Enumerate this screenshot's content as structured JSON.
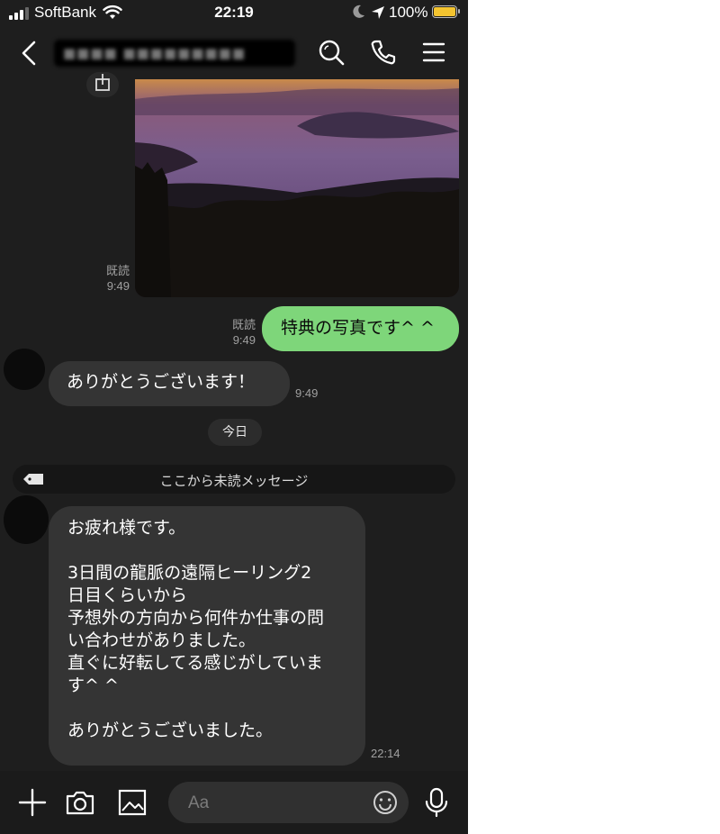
{
  "status_bar": {
    "carrier": "SoftBank",
    "time": "22:19",
    "battery_percent": "100%",
    "battery_level": 1.0,
    "battery_color": "#f4c430"
  },
  "header": {
    "title_redacted": "■■■■ ■■■■■■■■■",
    "icons": [
      "back-chevron-icon",
      "search-icon",
      "phone-icon",
      "menu-icon"
    ]
  },
  "messages": {
    "photo": {
      "read_label": "既読",
      "time": "9:49"
    },
    "sent": {
      "text": "特典の写真です^ ^",
      "read_label": "既読",
      "time": "9:49"
    },
    "reply": {
      "text": "ありがとうございます！",
      "time": "9:49"
    },
    "date_divider": "今日",
    "unread_divider": "ここから未読メッセージ",
    "long": {
      "text": "お疲れ様です。\n\n3日間の龍脈の遠隔ヒーリング2\n日目くらいから\n予想外の方向から何件か仕事の問\nい合わせがありました。\n直ぐに好転してる感じがしていま\nす^ ^\n\nありがとうございました。",
      "time": "22:14"
    }
  },
  "input_bar": {
    "placeholder": "Aa",
    "icons": [
      "plus-icon",
      "camera-icon",
      "image-icon",
      "emoji-icon",
      "microphone-icon"
    ]
  },
  "colors": {
    "background": "#1e1e1e",
    "sent_bubble": "#7ed67a",
    "received_bubble": "#343434"
  }
}
